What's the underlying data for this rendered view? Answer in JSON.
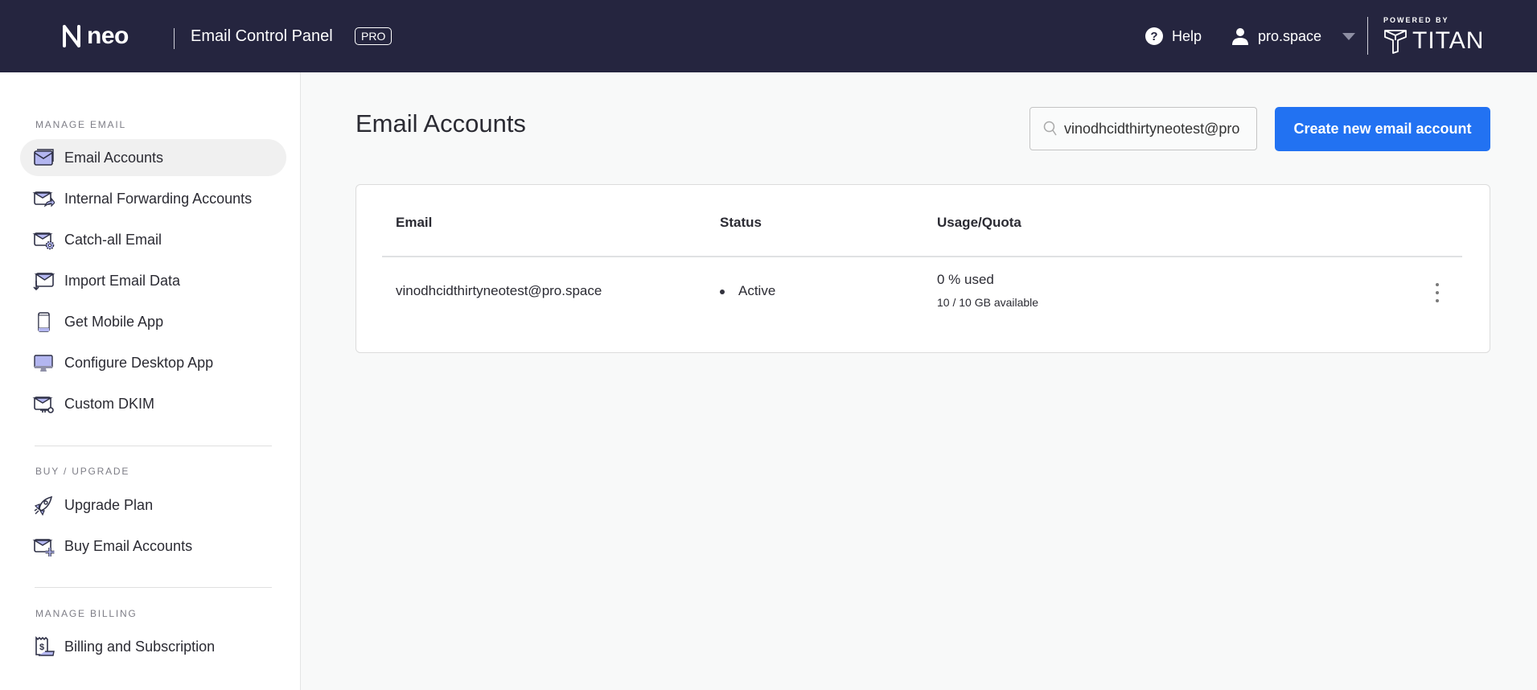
{
  "header": {
    "logo": "neo",
    "app_title": "Email Control Panel",
    "badge": "PRO",
    "help": "Help",
    "user": "pro.space",
    "powered_by": "POWERED BY",
    "partner": "TITAN",
    "bg_color": "#25253f"
  },
  "sidebar": {
    "sections": [
      {
        "label": "MANAGE EMAIL",
        "items": [
          {
            "label": "Email Accounts",
            "icon": "email-accounts-icon",
            "active": true
          },
          {
            "label": "Internal Forwarding Accounts",
            "icon": "forwarding-icon"
          },
          {
            "label": "Catch-all Email",
            "icon": "catch-all-icon"
          },
          {
            "label": "Import Email Data",
            "icon": "import-icon"
          },
          {
            "label": "Get Mobile App",
            "icon": "mobile-icon"
          },
          {
            "label": "Configure Desktop App",
            "icon": "desktop-icon"
          },
          {
            "label": "Custom DKIM",
            "icon": "dkim-key-icon"
          }
        ]
      },
      {
        "label": "BUY / UPGRADE",
        "items": [
          {
            "label": "Upgrade Plan",
            "icon": "rocket-icon"
          },
          {
            "label": "Buy Email Accounts",
            "icon": "buy-email-icon"
          }
        ]
      },
      {
        "label": "MANAGE BILLING",
        "items": [
          {
            "label": "Billing and Subscription",
            "icon": "billing-receipt-icon"
          }
        ]
      }
    ]
  },
  "main": {
    "title": "Email Accounts",
    "search_value": "vinodhcidthirtyneotest@pro.space",
    "create_button": "Create new email account",
    "accent_color": "#2272f2",
    "table": {
      "columns": [
        "Email",
        "Status",
        "Usage/Quota"
      ],
      "rows": [
        {
          "email": "vinodhcidthirtyneotest@pro.space",
          "status": "Active",
          "usage": "0 % used",
          "available": "10 / 10 GB available"
        }
      ]
    }
  }
}
